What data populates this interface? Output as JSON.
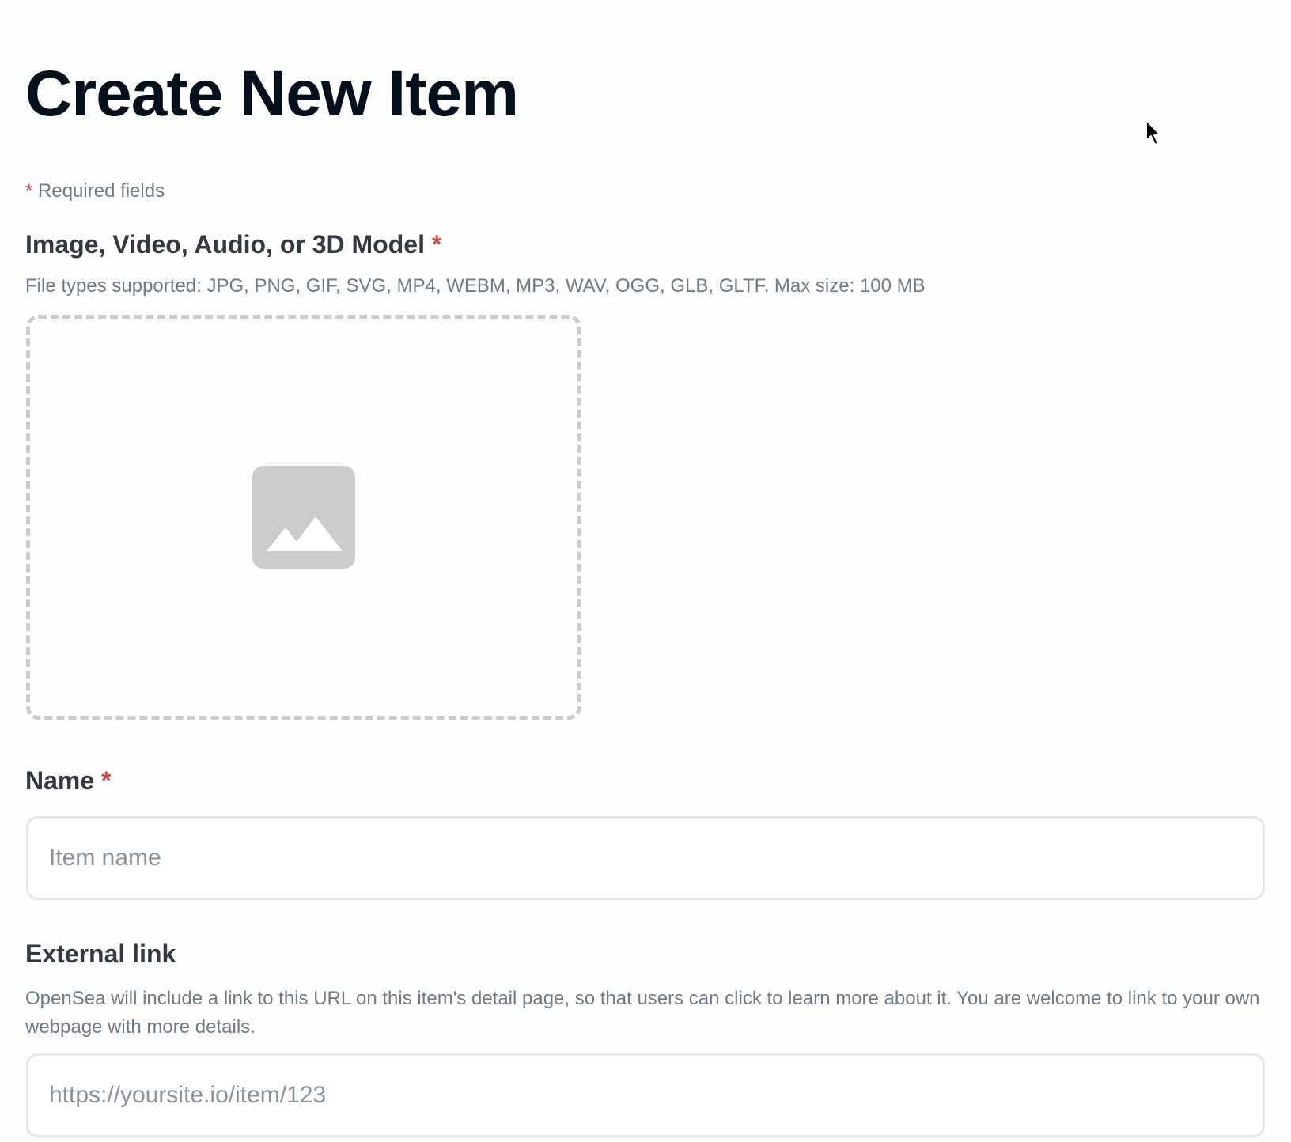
{
  "page": {
    "title": "Create New Item",
    "required_asterisk": "*",
    "required_note": "Required fields"
  },
  "media": {
    "label": "Image, Video, Audio, or 3D Model",
    "required_mark": "*",
    "help": "File types supported: JPG, PNG, GIF, SVG, MP4, WEBM, MP3, WAV, OGG, GLB, GLTF. Max size: 100 MB",
    "icon": "image-placeholder-icon"
  },
  "name": {
    "label": "Name",
    "required_mark": "*",
    "placeholder": "Item name",
    "value": ""
  },
  "external_link": {
    "label": "External link",
    "help": "OpenSea will include a link to this URL on this item's detail page, so that users can click to learn more about it. You are welcome to link to your own webpage with more details.",
    "placeholder": "https://yoursite.io/item/123",
    "value": ""
  },
  "colors": {
    "title": "#04111d",
    "label": "#353840",
    "help": "#707a83",
    "required": "#c94b4b",
    "border": "#e5e8eb",
    "dropzone_border": "#cccccc",
    "icon": "#cccccc"
  }
}
